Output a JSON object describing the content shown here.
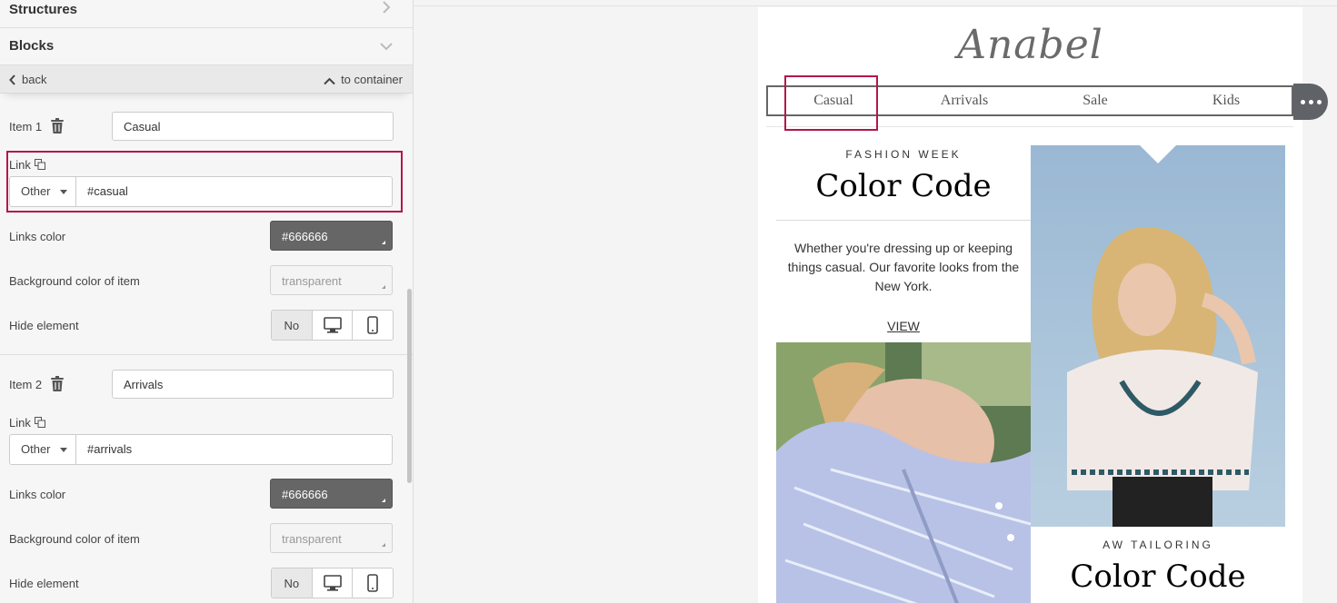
{
  "panel": {
    "structures_label": "Structures",
    "blocks_label": "Blocks",
    "back_label": "back",
    "to_container_label": "to container",
    "items": [
      {
        "item_label": "Item 1",
        "name_value": "Casual",
        "link_label": "Link",
        "link_type": "Other",
        "link_value": "#casual",
        "links_color_label": "Links color",
        "links_color_value": "#666666",
        "bg_color_label": "Background color of item",
        "bg_color_value": "transparent",
        "hide_label": "Hide element",
        "hide_no_label": "No"
      },
      {
        "item_label": "Item 2",
        "name_value": "Arrivals",
        "link_label": "Link",
        "link_type": "Other",
        "link_value": "#arrivals",
        "links_color_label": "Links color",
        "links_color_value": "#666666",
        "bg_color_label": "Background color of item",
        "bg_color_value": "transparent",
        "hide_label": "Hide element",
        "hide_no_label": "No"
      }
    ]
  },
  "preview": {
    "logo": "Anabel",
    "menu": [
      "Casual",
      "Arrivals",
      "Sale",
      "Kids"
    ],
    "left_column": {
      "eyebrow": "FASHION WEEK",
      "heading": "Color Code",
      "body": "Whether you're dressing up or keeping things casual. Our favorite looks from the New York.",
      "link": "VIEW"
    },
    "right_column": {
      "eyebrow": "AW TAILORING",
      "heading": "Color Code"
    }
  },
  "colors": {
    "highlight": "#b3174a",
    "links_color": "#666666"
  },
  "icons": [
    "chevron-right-icon",
    "chevron-down-icon",
    "chevron-left-icon",
    "chevron-up-icon",
    "trash-icon",
    "copy-icon",
    "desktop-icon",
    "mobile-icon",
    "more-icon"
  ]
}
